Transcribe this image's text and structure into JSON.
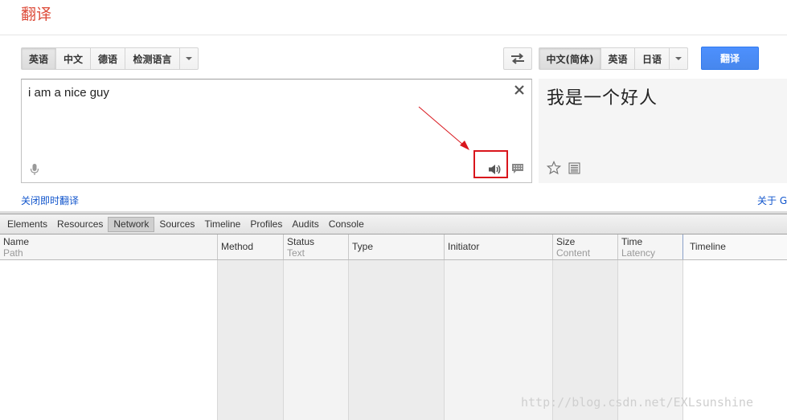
{
  "app": {
    "title": "翻译"
  },
  "source_langs": {
    "items": [
      "英语",
      "中文",
      "德语",
      "检测语言"
    ],
    "selected": 0
  },
  "target_langs": {
    "items": [
      "中文(简体)",
      "英语",
      "日语"
    ],
    "selected": 0
  },
  "translate_button": "翻译",
  "source": {
    "text": "i am a nice guy"
  },
  "result": {
    "text": "我是一个好人"
  },
  "links": {
    "instant_off": "关闭即时翻译",
    "about": "关于 G"
  },
  "devtools": {
    "tabs": [
      "Elements",
      "Resources",
      "Network",
      "Sources",
      "Timeline",
      "Profiles",
      "Audits",
      "Console"
    ],
    "active_tab": 2,
    "columns": [
      {
        "main": "Name",
        "sub": "Path"
      },
      {
        "main": "Method",
        "sub": ""
      },
      {
        "main": "Status",
        "sub": "Text"
      },
      {
        "main": "Type",
        "sub": ""
      },
      {
        "main": "Initiator",
        "sub": ""
      },
      {
        "main": "Size",
        "sub": "Content"
      },
      {
        "main": "Time",
        "sub": "Latency"
      },
      {
        "main": "Timeline",
        "sub": ""
      }
    ]
  },
  "watermark": "http://blog.csdn.net/EXLsunshine",
  "colors": {
    "accent_red": "#dd4b39",
    "button_blue": "#4d90fe",
    "highlight_red": "#d9151c",
    "link_blue": "#1155cc"
  }
}
